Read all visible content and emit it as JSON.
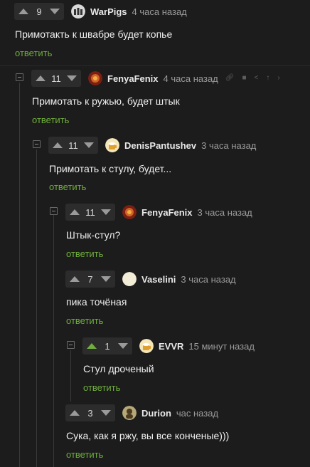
{
  "reply_label": "ответить",
  "comments": [
    {
      "author": "WarPigs",
      "time": "4 часа назад",
      "votes": "9",
      "text": "Примотакть к швабре будет копье",
      "avatar": "warpigs-avatar"
    },
    {
      "author": "FenyaFenix",
      "time": "4 часа назад",
      "votes": "11",
      "text": "Примотать к ружью, будет штык",
      "avatar": "fenyafenix-avatar"
    },
    {
      "author": "DenisPantushev",
      "time": "3 часа назад",
      "votes": "11",
      "text": "Примотать к стулу, будет...",
      "avatar": "denispantushev-avatar"
    },
    {
      "author": "FenyaFenix",
      "time": "3 часа назад",
      "votes": "11",
      "text": "Штык-стул?",
      "avatar": "fenyafenix-avatar"
    },
    {
      "author": "Vaselini",
      "time": "3 часа назад",
      "votes": "7",
      "text": "пика точёная",
      "avatar": "vaselini-avatar"
    },
    {
      "author": "EVVR",
      "time": "15 минут назад",
      "votes": "1",
      "text": "Стул дроченый",
      "avatar": "evvr-avatar",
      "upvoted": true
    },
    {
      "author": "Durion",
      "time": "час назад",
      "votes": "3",
      "text": "Сука, как я ржу, вы все конченые)))",
      "avatar": "durion-avatar"
    }
  ],
  "toolbar_icons": [
    "link-icon",
    "save-icon",
    "share-icon",
    "pin-icon",
    "more-icon"
  ],
  "colors": {
    "background": "#1c1c1c",
    "reply": "#6fae3c",
    "muted": "#9b9b9b"
  }
}
